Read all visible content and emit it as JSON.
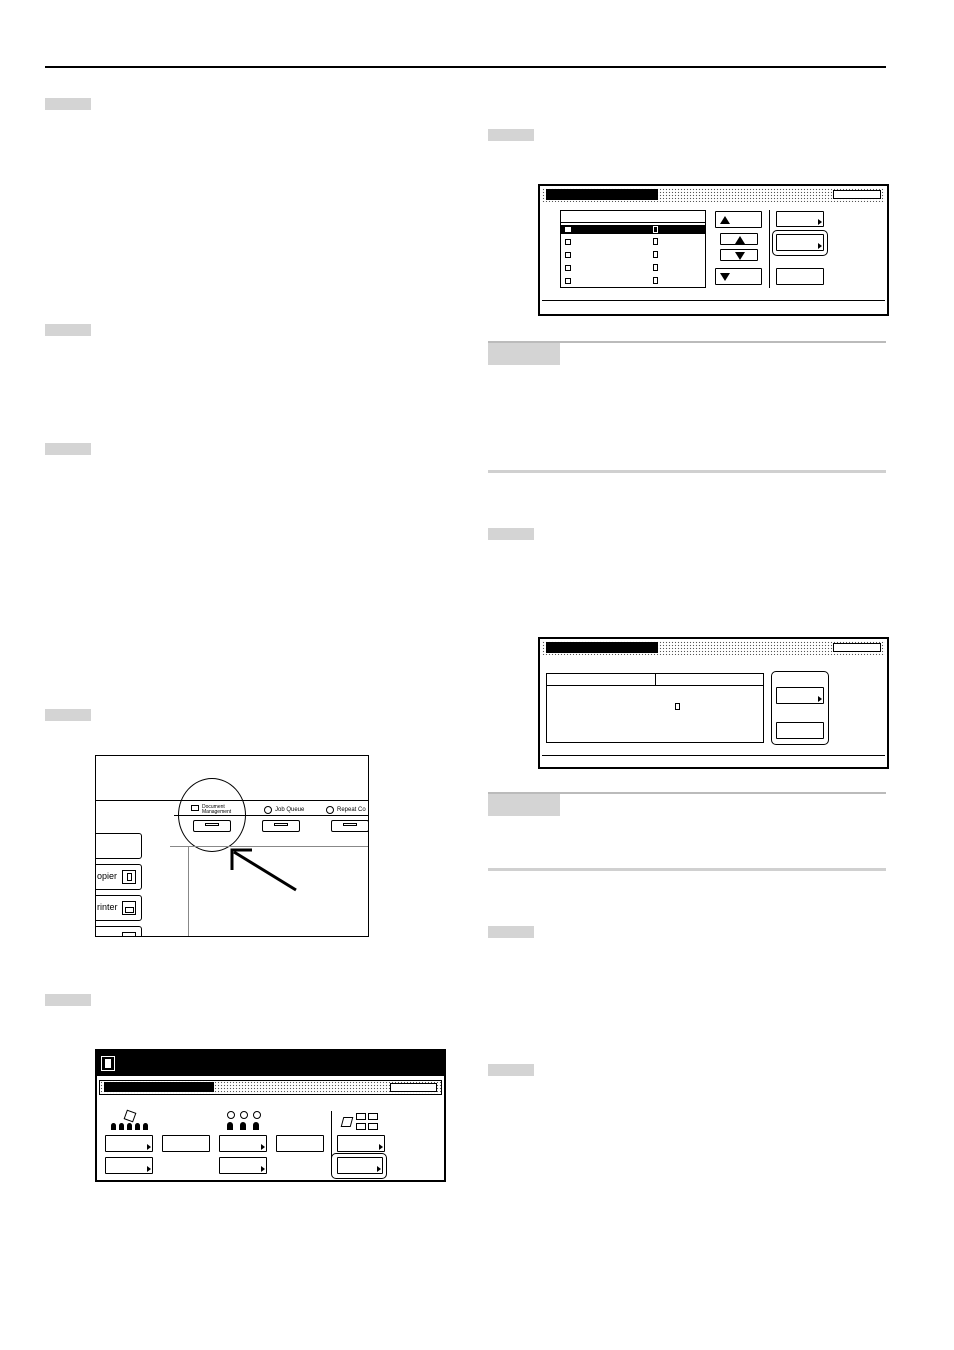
{
  "control_panel": {
    "document_management": "Document\nManagement",
    "job_queue": "Job Queue",
    "repeat_copy": "Repeat Co",
    "copier": "opier",
    "printer": "rinter"
  }
}
